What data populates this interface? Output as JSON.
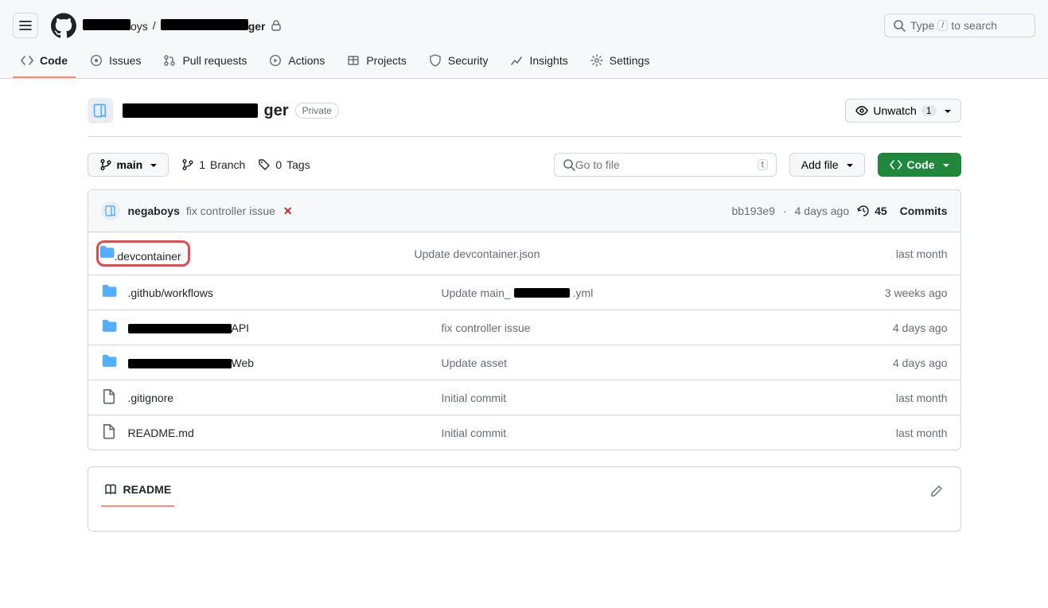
{
  "header": {
    "owner_suffix": "oys",
    "repo_suffix": "ger",
    "search_prefix": "Type",
    "search_key": "/",
    "search_suffix": "to search"
  },
  "tabs": {
    "code": "Code",
    "issues": "Issues",
    "pulls": "Pull requests",
    "actions": "Actions",
    "projects": "Projects",
    "security": "Security",
    "insights": "Insights",
    "settings": "Settings"
  },
  "repo": {
    "name_suffix": "ger",
    "visibility": "Private",
    "unwatch_label": "Unwatch",
    "unwatch_count": "1"
  },
  "actions": {
    "branch_name": "main",
    "branch_count": "1",
    "branch_word": "Branch",
    "tag_count": "0",
    "tag_word": "Tags",
    "goto_placeholder": "Go to file",
    "goto_key": "t",
    "add_file": "Add file",
    "code_btn": "Code"
  },
  "last_commit": {
    "author": "negaboys",
    "message": "fix controller issue",
    "status_fail": "✕",
    "sha": "bb193e9",
    "when": "4 days ago",
    "commits_count": "45",
    "commits_word": "Commits"
  },
  "files": [
    {
      "type": "dir",
      "name": ".devcontainer",
      "highlight": true,
      "msg": "Update devcontainer.json",
      "when": "last month"
    },
    {
      "type": "dir",
      "name": ".github/workflows",
      "msg_pre": "Update main_",
      "msg_post": ".yml",
      "redact_w": 70,
      "when": "3 weeks ago"
    },
    {
      "type": "dir",
      "name_pre": "",
      "name_post": "API",
      "name_redact_w": 130,
      "msg": "fix controller issue",
      "when": "4 days ago"
    },
    {
      "type": "dir",
      "name_pre": "",
      "name_post": "Web",
      "name_redact_w": 130,
      "msg": "Update asset",
      "when": "4 days ago"
    },
    {
      "type": "file",
      "name": ".gitignore",
      "msg": "Initial commit",
      "when": "last month"
    },
    {
      "type": "file",
      "name": "README.md",
      "msg": "Initial commit",
      "when": "last month"
    }
  ],
  "readme": {
    "label": "README"
  }
}
